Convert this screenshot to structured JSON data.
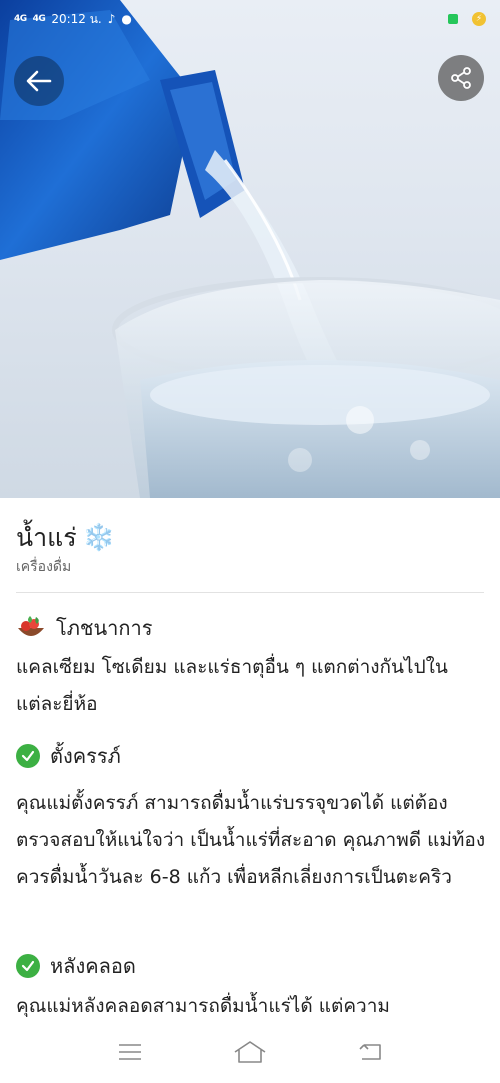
{
  "status_bar": {
    "signal_1": "4G",
    "signal_2": "4G",
    "time": "20:12 น."
  },
  "header": {
    "back_icon": "arrow-left-icon",
    "share_icon": "share-icon"
  },
  "item": {
    "title": "น้ำแร่",
    "title_emoji": "❄️",
    "category": "เครื่องดื่ม"
  },
  "sections": [
    {
      "icon": "salad-bowl-icon",
      "heading": "โภชนาการ",
      "text": "แคลเซียม โซเดียม และแร่ธาตุอื่น ๆ แตกต่างกันไปในแต่ละยี่ห้อ"
    },
    {
      "icon": "check-circle-icon",
      "heading": "ตั้งครรภ์",
      "text": "คุณแม่ตั้งครรภ์ สามารถดื่มน้ำแร่บรรจุขวดได้ แต่ต้องตรวจสอบให้แน่ใจว่า เป็นน้ำแร่ที่สะอาด คุณภาพดี แม่ท้องควรดื่มน้ำวันละ 6-8 แก้ว เพื่อหลีกเลี่ยงการเป็นตะคริว"
    },
    {
      "icon": "check-circle-icon",
      "heading": "หลังคลอด",
      "text": "คุณแม่หลังคลอดสามารถดื่มน้ำแร่ได้ แต่ความ"
    }
  ],
  "nav": {
    "menu_icon": "menu-icon",
    "home_icon": "home-icon",
    "back_icon": "back-icon"
  },
  "colors": {
    "check_green": "#3cb043",
    "bottle_blue": "#1a5fc4"
  }
}
